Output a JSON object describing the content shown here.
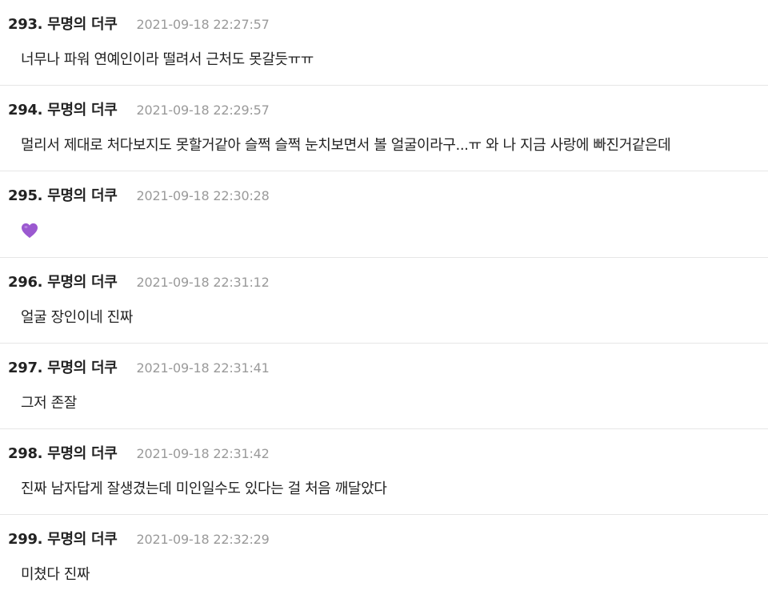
{
  "comments": [
    {
      "number": "293.",
      "author": "무명의 더쿠",
      "timestamp": "2021-09-18 22:27:57",
      "text": "너무나 파워 연예인이라 떨려서 근처도 못갈듯ㅠㅠ"
    },
    {
      "number": "294.",
      "author": "무명의 더쿠",
      "timestamp": "2021-09-18 22:29:57",
      "text": "멀리서 제대로 처다보지도 못할거같아 슬쩍 슬쩍 눈치보면서 볼 얼굴이라구...ㅠ 와 나 지금 사랑에 빠진거같은데"
    },
    {
      "number": "295.",
      "author": "무명의 더쿠",
      "timestamp": "2021-09-18 22:30:28",
      "text": "",
      "icon": "purple-heart-icon",
      "icon_color": "#9b59d0"
    },
    {
      "number": "296.",
      "author": "무명의 더쿠",
      "timestamp": "2021-09-18 22:31:12",
      "text": "얼굴 장인이네 진짜"
    },
    {
      "number": "297.",
      "author": "무명의 더쿠",
      "timestamp": "2021-09-18 22:31:41",
      "text": "그저 존잘"
    },
    {
      "number": "298.",
      "author": "무명의 더쿠",
      "timestamp": "2021-09-18 22:31:42",
      "text": "진짜 남자답게 잘생겼는데 미인일수도 있다는 걸 처음 깨달았다"
    },
    {
      "number": "299.",
      "author": "무명의 더쿠",
      "timestamp": "2021-09-18 22:32:29",
      "text": "미쳤다 진짜"
    }
  ]
}
